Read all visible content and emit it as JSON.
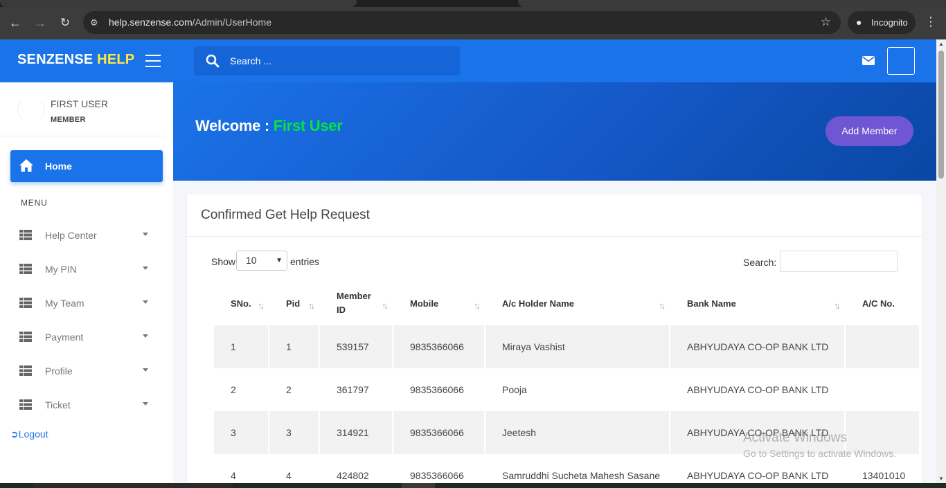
{
  "browser": {
    "url_host": "help.senzense.com",
    "url_path": "/Admin/UserHome",
    "incognito_label": "Incognito"
  },
  "brand": {
    "part1": "SENZENSE ",
    "part2": "HELP"
  },
  "header": {
    "search_placeholder": "Search ..."
  },
  "user": {
    "name": "FIRST USER",
    "role": "MEMBER"
  },
  "sidebar": {
    "home_label": "Home",
    "menu_heading": "MENU",
    "items": [
      {
        "label": "Help Center"
      },
      {
        "label": "My PIN"
      },
      {
        "label": "My Team"
      },
      {
        "label": "Payment"
      },
      {
        "label": "Profile"
      },
      {
        "label": "Ticket"
      }
    ],
    "logout_label": "Logout"
  },
  "banner": {
    "welcome_prefix": "Welcome : ",
    "welcome_name": "First User",
    "add_member_label": "Add Member"
  },
  "card": {
    "title": "Confirmed Get Help Request",
    "show_label": "Show",
    "entries_value": "10",
    "entries_label": "entries",
    "search_label": "Search:"
  },
  "table": {
    "columns": [
      "SNo.",
      "Pid",
      "Member ID",
      "Mobile",
      "A/c Holder Name",
      "Bank Name",
      "A/C No."
    ],
    "rows": [
      [
        "1",
        "1",
        "539157",
        "9835366066",
        "Miraya Vashist",
        "ABHYUDAYA CO-OP BANK LTD",
        ""
      ],
      [
        "2",
        "2",
        "361797",
        "9835366066",
        "Pooja",
        "ABHYUDAYA CO-OP BANK LTD",
        ""
      ],
      [
        "3",
        "3",
        "314921",
        "9835366066",
        "Jeetesh",
        "ABHYUDAYA CO-OP BANK LTD",
        ""
      ],
      [
        "4",
        "4",
        "424802",
        "9835366066",
        "Samruddhi Sucheta Mahesh Sasane",
        "ABHYUDAYA CO-OP BANK LTD",
        "13401010"
      ]
    ]
  },
  "overlay": {
    "activate_title": "Activate Windows",
    "activate_sub": "Go to Settings to activate Windows."
  },
  "colors": {
    "primary": "#1a73e8",
    "brand_accent": "#ffeb3b",
    "welcome_name": "#00e640",
    "add_member": "#6f56d3"
  }
}
